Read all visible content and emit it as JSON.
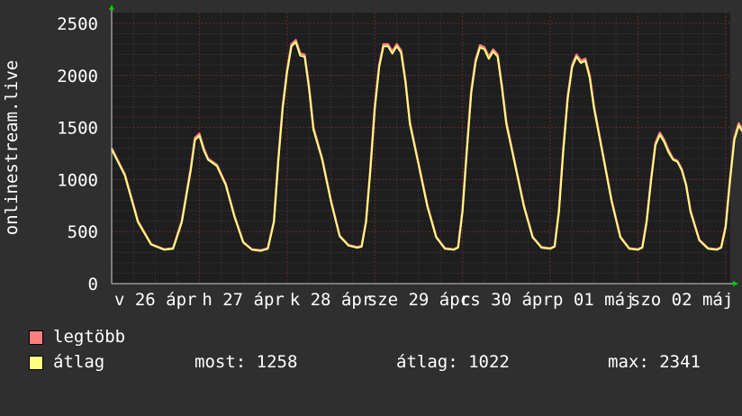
{
  "chart_data": {
    "type": "line",
    "ylabel": "onlinestream.live",
    "ylim": [
      0,
      2500
    ],
    "yticks": [
      0,
      500,
      1000,
      1500,
      2000,
      2500
    ],
    "x_tick_labels": [
      "v 26 ápr",
      "h 27 ápr",
      "k 28 ápr",
      "sze 29 ápr",
      "cs 30 ápr",
      "p 01 máj",
      "szo 02 máj"
    ],
    "x_range_days": [
      0,
      7.35
    ],
    "grid": true,
    "series": [
      {
        "name": "legtöbb",
        "color": "#ff7f7f",
        "points": [
          [
            0,
            1300
          ],
          [
            0.15,
            1050
          ],
          [
            0.3,
            600
          ],
          [
            0.45,
            380
          ],
          [
            0.6,
            330
          ],
          [
            0.7,
            340
          ],
          [
            0.8,
            600
          ],
          [
            0.9,
            1100
          ],
          [
            0.95,
            1400
          ],
          [
            1.0,
            1440
          ],
          [
            1.05,
            1300
          ],
          [
            1.1,
            1200
          ],
          [
            1.2,
            1140
          ],
          [
            1.3,
            960
          ],
          [
            1.4,
            650
          ],
          [
            1.5,
            400
          ],
          [
            1.6,
            330
          ],
          [
            1.7,
            320
          ],
          [
            1.78,
            340
          ],
          [
            1.85,
            600
          ],
          [
            1.9,
            1200
          ],
          [
            1.95,
            1700
          ],
          [
            2.0,
            2050
          ],
          [
            2.05,
            2300
          ],
          [
            2.1,
            2340
          ],
          [
            2.15,
            2210
          ],
          [
            2.2,
            2200
          ],
          [
            2.25,
            1900
          ],
          [
            2.3,
            1500
          ],
          [
            2.4,
            1200
          ],
          [
            2.5,
            800
          ],
          [
            2.6,
            460
          ],
          [
            2.7,
            370
          ],
          [
            2.8,
            350
          ],
          [
            2.85,
            360
          ],
          [
            2.9,
            600
          ],
          [
            2.95,
            1100
          ],
          [
            3.0,
            1700
          ],
          [
            3.05,
            2100
          ],
          [
            3.1,
            2300
          ],
          [
            3.15,
            2300
          ],
          [
            3.2,
            2230
          ],
          [
            3.25,
            2300
          ],
          [
            3.3,
            2240
          ],
          [
            3.35,
            1950
          ],
          [
            3.4,
            1550
          ],
          [
            3.5,
            1150
          ],
          [
            3.6,
            750
          ],
          [
            3.7,
            450
          ],
          [
            3.8,
            340
          ],
          [
            3.9,
            330
          ],
          [
            3.95,
            350
          ],
          [
            4.0,
            700
          ],
          [
            4.05,
            1300
          ],
          [
            4.1,
            1850
          ],
          [
            4.15,
            2150
          ],
          [
            4.2,
            2290
          ],
          [
            4.25,
            2270
          ],
          [
            4.3,
            2180
          ],
          [
            4.35,
            2250
          ],
          [
            4.4,
            2200
          ],
          [
            4.45,
            1900
          ],
          [
            4.5,
            1550
          ],
          [
            4.6,
            1150
          ],
          [
            4.7,
            750
          ],
          [
            4.8,
            450
          ],
          [
            4.9,
            350
          ],
          [
            5.0,
            340
          ],
          [
            5.05,
            360
          ],
          [
            5.1,
            700
          ],
          [
            5.15,
            1300
          ],
          [
            5.2,
            1800
          ],
          [
            5.25,
            2100
          ],
          [
            5.3,
            2200
          ],
          [
            5.35,
            2140
          ],
          [
            5.4,
            2160
          ],
          [
            5.45,
            2000
          ],
          [
            5.5,
            1700
          ],
          [
            5.6,
            1250
          ],
          [
            5.7,
            800
          ],
          [
            5.8,
            450
          ],
          [
            5.9,
            340
          ],
          [
            6.0,
            330
          ],
          [
            6.05,
            350
          ],
          [
            6.1,
            600
          ],
          [
            6.15,
            1000
          ],
          [
            6.2,
            1350
          ],
          [
            6.25,
            1450
          ],
          [
            6.3,
            1380
          ],
          [
            6.35,
            1280
          ],
          [
            6.4,
            1200
          ],
          [
            6.45,
            1180
          ],
          [
            6.5,
            1100
          ],
          [
            6.55,
            950
          ],
          [
            6.6,
            700
          ],
          [
            6.7,
            420
          ],
          [
            6.8,
            340
          ],
          [
            6.9,
            330
          ],
          [
            6.95,
            350
          ],
          [
            7.0,
            550
          ],
          [
            7.05,
            1000
          ],
          [
            7.1,
            1400
          ],
          [
            7.15,
            1540
          ],
          [
            7.2,
            1470
          ],
          [
            7.25,
            1380
          ],
          [
            7.3,
            1290
          ],
          [
            7.35,
            1258
          ]
        ]
      },
      {
        "name": "átlag",
        "color": "#ffff80",
        "points": [
          [
            0,
            1290
          ],
          [
            0.15,
            1040
          ],
          [
            0.3,
            590
          ],
          [
            0.45,
            375
          ],
          [
            0.6,
            325
          ],
          [
            0.7,
            335
          ],
          [
            0.8,
            590
          ],
          [
            0.9,
            1080
          ],
          [
            0.95,
            1380
          ],
          [
            1.0,
            1420
          ],
          [
            1.05,
            1280
          ],
          [
            1.1,
            1190
          ],
          [
            1.2,
            1130
          ],
          [
            1.3,
            950
          ],
          [
            1.4,
            640
          ],
          [
            1.5,
            395
          ],
          [
            1.6,
            325
          ],
          [
            1.7,
            315
          ],
          [
            1.78,
            335
          ],
          [
            1.85,
            590
          ],
          [
            1.9,
            1180
          ],
          [
            1.95,
            1680
          ],
          [
            2.0,
            2030
          ],
          [
            2.05,
            2280
          ],
          [
            2.1,
            2320
          ],
          [
            2.15,
            2190
          ],
          [
            2.2,
            2180
          ],
          [
            2.25,
            1880
          ],
          [
            2.3,
            1480
          ],
          [
            2.4,
            1190
          ],
          [
            2.5,
            790
          ],
          [
            2.6,
            455
          ],
          [
            2.7,
            365
          ],
          [
            2.8,
            345
          ],
          [
            2.85,
            355
          ],
          [
            2.9,
            590
          ],
          [
            2.95,
            1090
          ],
          [
            3.0,
            1680
          ],
          [
            3.05,
            2080
          ],
          [
            3.1,
            2280
          ],
          [
            3.15,
            2280
          ],
          [
            3.2,
            2210
          ],
          [
            3.25,
            2280
          ],
          [
            3.3,
            2220
          ],
          [
            3.35,
            1930
          ],
          [
            3.4,
            1530
          ],
          [
            3.5,
            1140
          ],
          [
            3.6,
            740
          ],
          [
            3.7,
            445
          ],
          [
            3.8,
            335
          ],
          [
            3.9,
            325
          ],
          [
            3.95,
            345
          ],
          [
            4.0,
            690
          ],
          [
            4.05,
            1280
          ],
          [
            4.1,
            1830
          ],
          [
            4.15,
            2130
          ],
          [
            4.2,
            2270
          ],
          [
            4.25,
            2250
          ],
          [
            4.3,
            2160
          ],
          [
            4.35,
            2230
          ],
          [
            4.4,
            2180
          ],
          [
            4.45,
            1880
          ],
          [
            4.5,
            1530
          ],
          [
            4.6,
            1140
          ],
          [
            4.7,
            740
          ],
          [
            4.8,
            445
          ],
          [
            4.9,
            345
          ],
          [
            5.0,
            335
          ],
          [
            5.05,
            355
          ],
          [
            5.1,
            690
          ],
          [
            5.15,
            1280
          ],
          [
            5.2,
            1780
          ],
          [
            5.25,
            2080
          ],
          [
            5.3,
            2180
          ],
          [
            5.35,
            2120
          ],
          [
            5.4,
            2140
          ],
          [
            5.45,
            1980
          ],
          [
            5.5,
            1680
          ],
          [
            5.6,
            1240
          ],
          [
            5.7,
            790
          ],
          [
            5.8,
            445
          ],
          [
            5.9,
            335
          ],
          [
            6.0,
            325
          ],
          [
            6.05,
            345
          ],
          [
            6.1,
            590
          ],
          [
            6.15,
            990
          ],
          [
            6.2,
            1330
          ],
          [
            6.25,
            1430
          ],
          [
            6.3,
            1360
          ],
          [
            6.35,
            1260
          ],
          [
            6.4,
            1190
          ],
          [
            6.45,
            1170
          ],
          [
            6.5,
            1090
          ],
          [
            6.55,
            940
          ],
          [
            6.6,
            690
          ],
          [
            6.7,
            415
          ],
          [
            6.8,
            335
          ],
          [
            6.9,
            325
          ],
          [
            6.95,
            345
          ],
          [
            7.0,
            540
          ],
          [
            7.05,
            990
          ],
          [
            7.1,
            1380
          ],
          [
            7.15,
            1520
          ],
          [
            7.2,
            1450
          ],
          [
            7.25,
            1360
          ],
          [
            7.3,
            1270
          ],
          [
            7.35,
            1250
          ]
        ]
      }
    ]
  },
  "legend": {
    "items": [
      {
        "label": "legtöbb",
        "color": "#ff7f7f"
      },
      {
        "label": "átlag",
        "color": "#ffff80"
      }
    ],
    "stats": {
      "most": "most: 1258",
      "atlag": "átlag: 1022",
      "max": "max: 2341"
    }
  },
  "colors": {
    "background": "#2f2f2f",
    "plot_background": "#1e1e1e",
    "grid_minor": "#3e3e3e",
    "grid_major": "#6a2a2a",
    "axis_arrow": "#00cc00"
  }
}
